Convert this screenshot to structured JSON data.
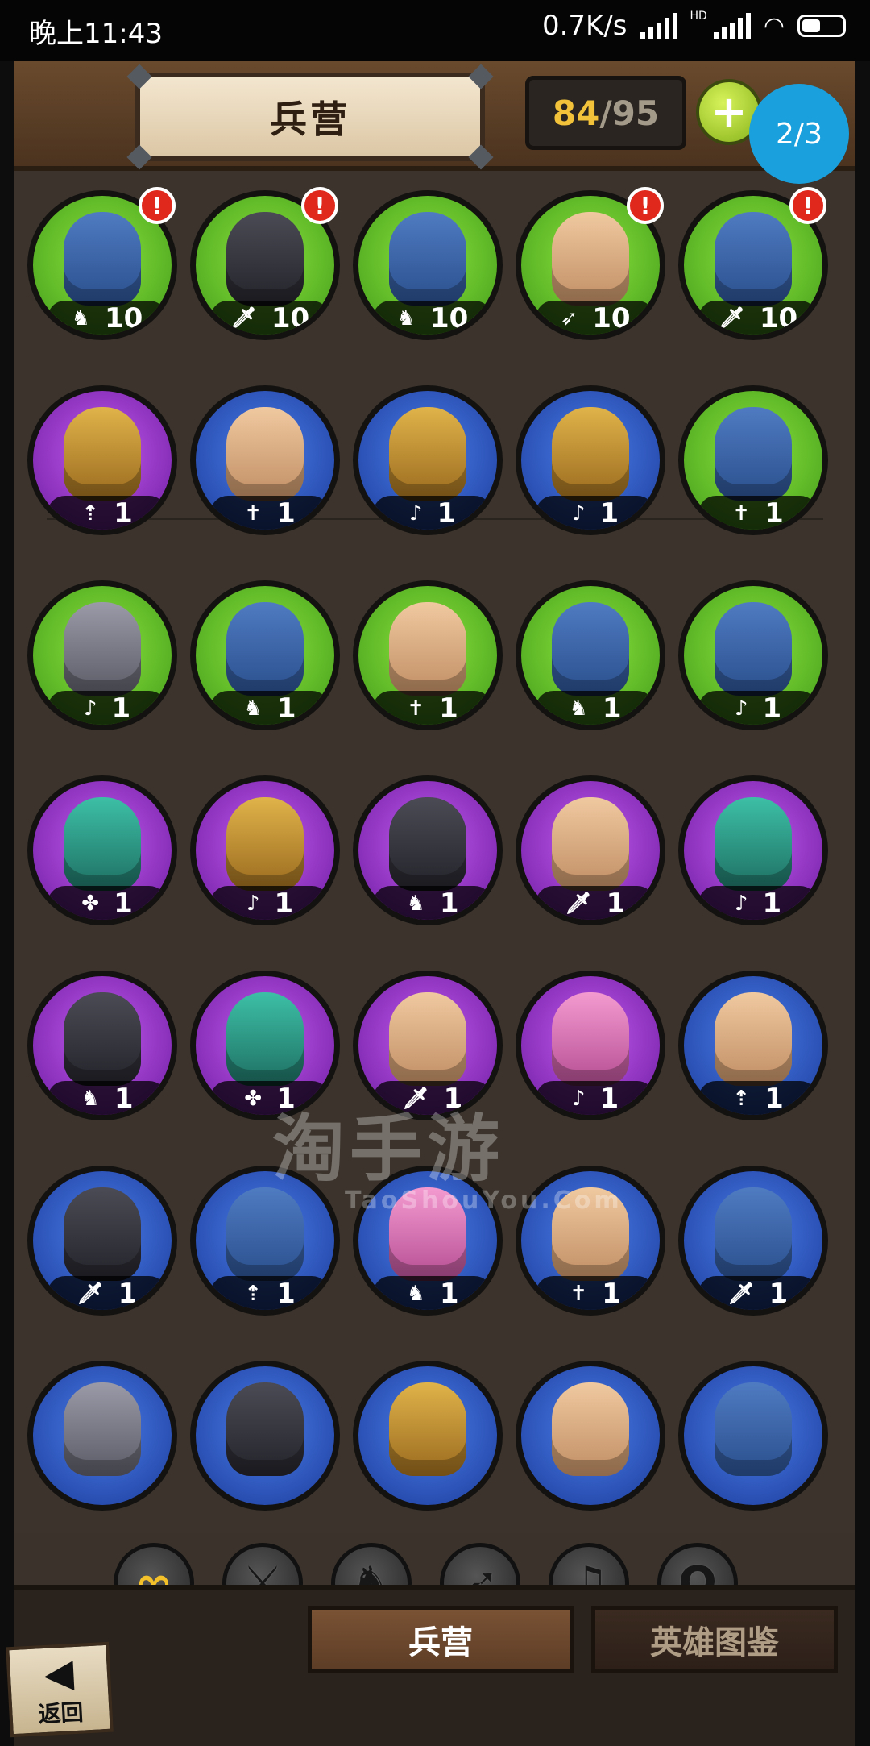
{
  "status_bar": {
    "time": "晚上11:43",
    "network_speed": "0.7K/s",
    "hd_label": "HD"
  },
  "header": {
    "title": "兵营",
    "count_current": "84",
    "count_separator": "/",
    "count_max": "95",
    "add_button_label": "+"
  },
  "page_indicator": "2/3",
  "units": [
    {
      "color": "green",
      "look": "helm",
      "type_icon": "horse-icon",
      "glyph": "♞",
      "level": "10",
      "alert": "!"
    },
    {
      "color": "green",
      "look": "dark",
      "type_icon": "sword-icon",
      "glyph": "🗡",
      "level": "10",
      "alert": "!"
    },
    {
      "color": "green",
      "look": "helm",
      "type_icon": "horse-icon",
      "glyph": "♞",
      "level": "10",
      "alert": ""
    },
    {
      "color": "green",
      "look": "skin",
      "type_icon": "bow-icon",
      "glyph": "➶",
      "level": "10",
      "alert": "!"
    },
    {
      "color": "green",
      "look": "helm",
      "type_icon": "sword-icon",
      "glyph": "🗡",
      "level": "10",
      "alert": "!"
    },
    {
      "color": "purple",
      "look": "gold",
      "type_icon": "spear-icon",
      "glyph": "⇡",
      "level": "1",
      "alert": ""
    },
    {
      "color": "blue",
      "look": "skin",
      "type_icon": "holy-icon",
      "glyph": "✝",
      "level": "1",
      "alert": ""
    },
    {
      "color": "blue",
      "look": "gold",
      "type_icon": "magic-icon",
      "glyph": "♪",
      "level": "1",
      "alert": ""
    },
    {
      "color": "blue",
      "look": "gold",
      "type_icon": "magic-icon",
      "glyph": "♪",
      "level": "1",
      "alert": ""
    },
    {
      "color": "green",
      "look": "helm",
      "type_icon": "holy-icon",
      "glyph": "✝",
      "level": "1",
      "alert": ""
    },
    {
      "color": "green",
      "look": "grey",
      "type_icon": "magic-icon",
      "glyph": "♪",
      "level": "1",
      "alert": ""
    },
    {
      "color": "green",
      "look": "helm",
      "type_icon": "horse-icon",
      "glyph": "♞",
      "level": "1",
      "alert": ""
    },
    {
      "color": "green",
      "look": "skin",
      "type_icon": "holy-icon",
      "glyph": "✝",
      "level": "1",
      "alert": ""
    },
    {
      "color": "green",
      "look": "helm",
      "type_icon": "horse-icon",
      "glyph": "♞",
      "level": "1",
      "alert": ""
    },
    {
      "color": "green",
      "look": "helm",
      "type_icon": "magic-icon",
      "glyph": "♪",
      "level": "1",
      "alert": ""
    },
    {
      "color": "purple",
      "look": "teal",
      "type_icon": "beast-icon",
      "glyph": "✤",
      "level": "1",
      "alert": ""
    },
    {
      "color": "purple",
      "look": "gold",
      "type_icon": "magic-icon",
      "glyph": "♪",
      "level": "1",
      "alert": ""
    },
    {
      "color": "purple",
      "look": "dark",
      "type_icon": "horse-icon",
      "glyph": "♞",
      "level": "1",
      "alert": ""
    },
    {
      "color": "purple",
      "look": "skin",
      "type_icon": "sword-icon",
      "glyph": "🗡",
      "level": "1",
      "alert": ""
    },
    {
      "color": "purple",
      "look": "teal",
      "type_icon": "magic-icon",
      "glyph": "♪",
      "level": "1",
      "alert": ""
    },
    {
      "color": "purple",
      "look": "dark",
      "type_icon": "horse-icon",
      "glyph": "♞",
      "level": "1",
      "alert": ""
    },
    {
      "color": "purple",
      "look": "teal",
      "type_icon": "beast-icon",
      "glyph": "✤",
      "level": "1",
      "alert": ""
    },
    {
      "color": "purple",
      "look": "skin",
      "type_icon": "sword-icon",
      "glyph": "🗡",
      "level": "1",
      "alert": ""
    },
    {
      "color": "purple",
      "look": "pink",
      "type_icon": "magic-icon",
      "glyph": "♪",
      "level": "1",
      "alert": ""
    },
    {
      "color": "blue",
      "look": "skin",
      "type_icon": "spear-icon",
      "glyph": "⇡",
      "level": "1",
      "alert": ""
    },
    {
      "color": "blue",
      "look": "dark",
      "type_icon": "sword-icon",
      "glyph": "🗡",
      "level": "1",
      "alert": ""
    },
    {
      "color": "blue",
      "look": "helm",
      "type_icon": "spear-icon",
      "glyph": "⇡",
      "level": "1",
      "alert": ""
    },
    {
      "color": "blue",
      "look": "pink",
      "type_icon": "horse-icon",
      "glyph": "♞",
      "level": "1",
      "alert": ""
    },
    {
      "color": "blue",
      "look": "skin",
      "type_icon": "holy-icon",
      "glyph": "✝",
      "level": "1",
      "alert": ""
    },
    {
      "color": "blue",
      "look": "helm",
      "type_icon": "sword-icon",
      "glyph": "🗡",
      "level": "1",
      "alert": ""
    },
    {
      "color": "blue",
      "look": "grey",
      "type_icon": "",
      "glyph": "",
      "level": "",
      "alert": ""
    },
    {
      "color": "blue",
      "look": "dark",
      "type_icon": "",
      "glyph": "",
      "level": "",
      "alert": ""
    },
    {
      "color": "blue",
      "look": "gold",
      "type_icon": "",
      "glyph": "",
      "level": "",
      "alert": ""
    },
    {
      "color": "blue",
      "look": "skin",
      "type_icon": "",
      "glyph": "",
      "level": "",
      "alert": ""
    },
    {
      "color": "blue",
      "look": "helm",
      "type_icon": "",
      "glyph": "",
      "level": "",
      "alert": ""
    }
  ],
  "watermark": {
    "text": "淘手游",
    "sub": "TaoShouYou.Com"
  },
  "filters": [
    {
      "label": "全部",
      "icon": "infinity-icon",
      "glyph": "∞"
    },
    {
      "label": "近战",
      "icon": "sword-icon",
      "glyph": "⚔"
    },
    {
      "label": "骑乘",
      "icon": "horse-icon",
      "glyph": "♞"
    },
    {
      "label": "远程",
      "icon": "bow-icon",
      "glyph": "➶"
    },
    {
      "label": "秘法",
      "icon": "magic-icon",
      "glyph": "♫"
    },
    {
      "label": "众神",
      "icon": "omega-icon",
      "glyph": "Ω"
    }
  ],
  "bottom_tabs": {
    "barracks": "兵营",
    "hero_codex": "英雄图鉴"
  },
  "back_button": {
    "label": "返回",
    "arrow": "◀"
  }
}
